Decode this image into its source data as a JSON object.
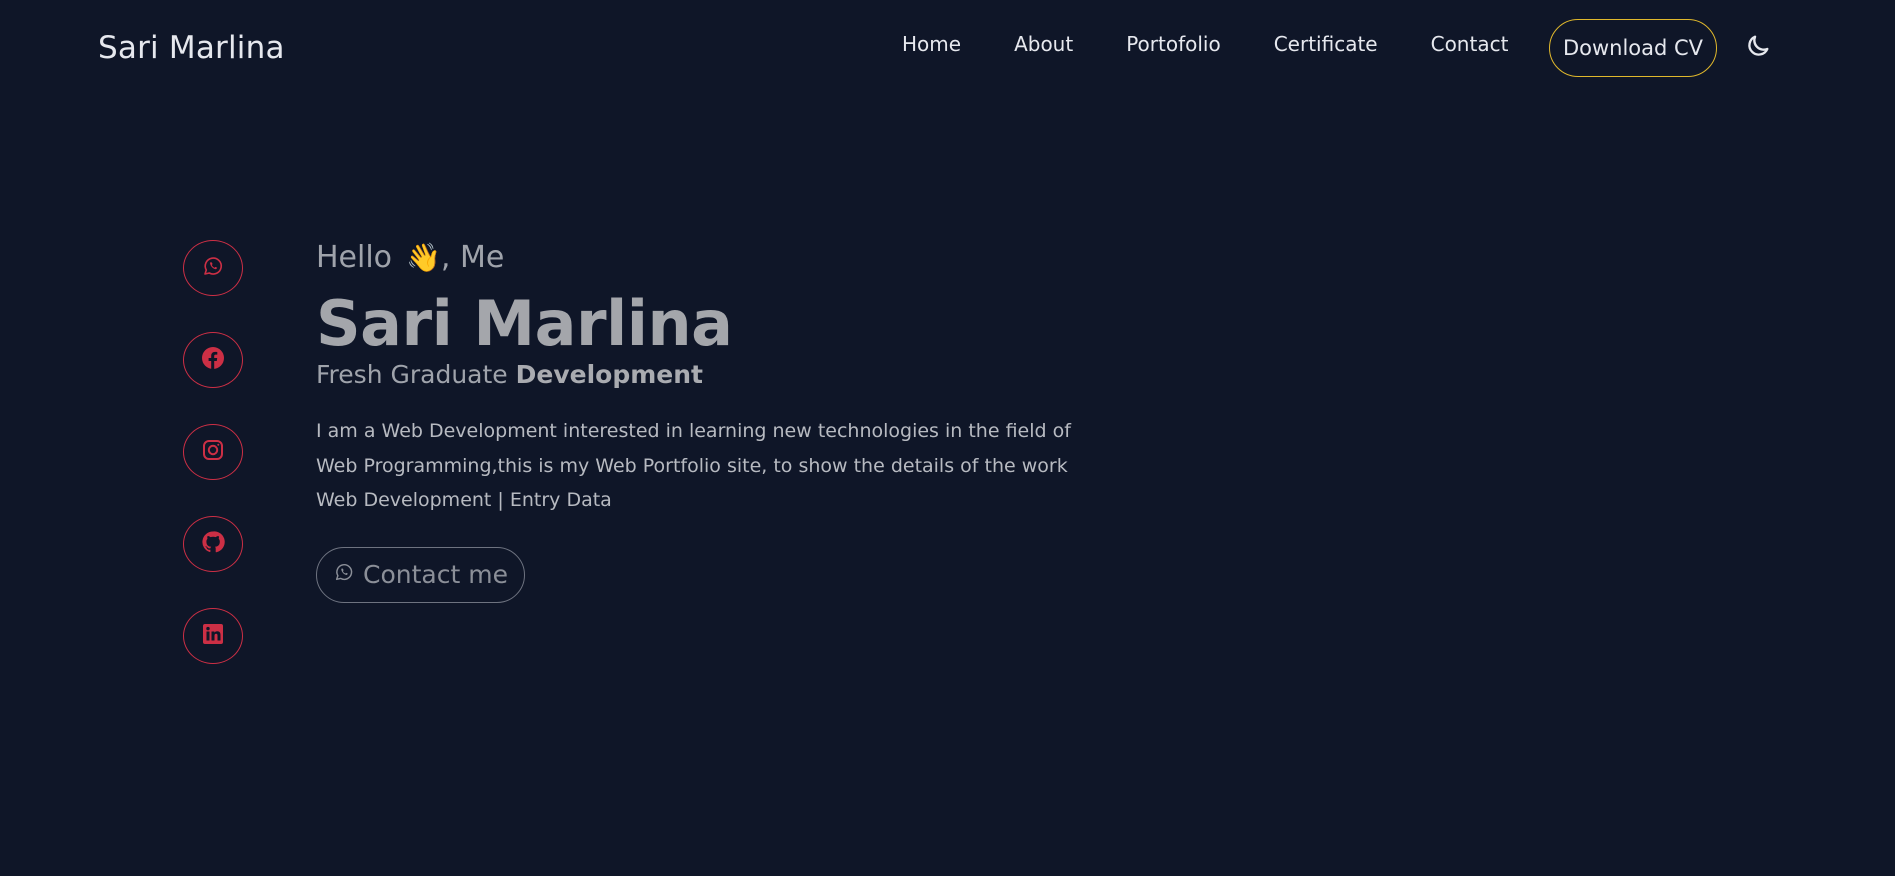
{
  "brand": {
    "name": "Sari Marlina"
  },
  "nav": {
    "links": [
      "Home",
      "About",
      "Portofolio",
      "Certificate",
      "Contact"
    ],
    "download_label": "Download CV",
    "theme_icon": "moon-icon"
  },
  "social": {
    "items": [
      {
        "icon": "whatsapp-icon"
      },
      {
        "icon": "facebook-icon"
      },
      {
        "icon": "instagram-icon"
      },
      {
        "icon": "github-icon"
      },
      {
        "icon": "linkedin-icon"
      }
    ],
    "accent_color": "#cc2f45"
  },
  "hero": {
    "greeting_prefix": "Hello",
    "greeting_emoji": "👋",
    "greeting_suffix": ", Me",
    "name": "Sari Marlina",
    "subtitle_prefix": "Fresh Graduate",
    "subtitle_bold": "Development",
    "description": "I am a Web Development interested in learning new technologies in the field of Web Programming,this is my Web Portfolio site, to show the details of the work",
    "tags": "Web Development | Entry Data",
    "contact_label": "Contact me"
  },
  "colors": {
    "background": "#0f1628",
    "download_border": "#e0b82c"
  }
}
